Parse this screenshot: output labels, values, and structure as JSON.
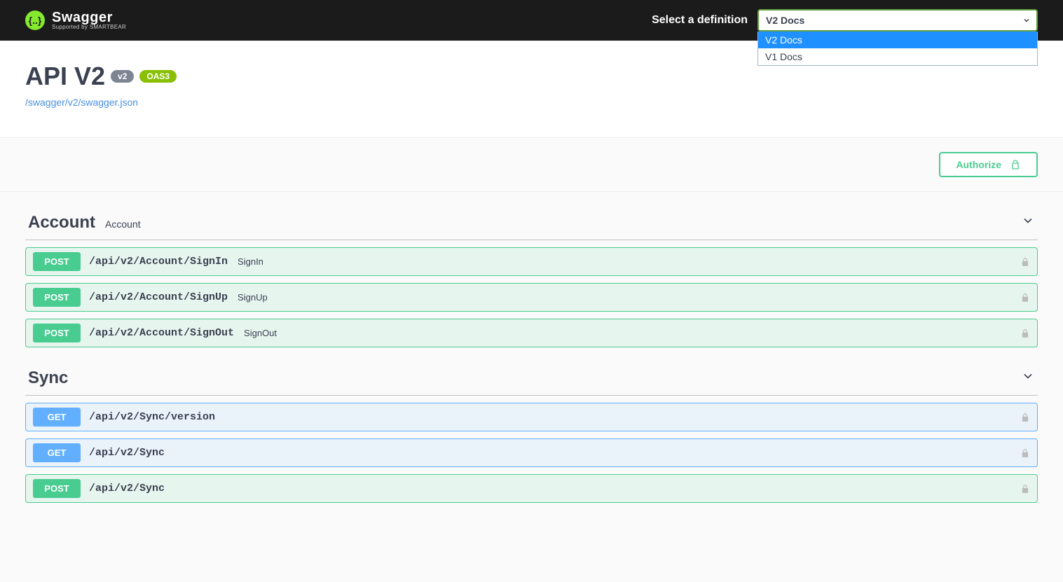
{
  "topbar": {
    "brand": "Swagger",
    "brandSub": "Supported by SMARTBEAR",
    "selectLabel": "Select a definition",
    "selected": "V2 Docs",
    "options": [
      "V2 Docs",
      "V1 Docs"
    ]
  },
  "info": {
    "title": "API V2",
    "version": "v2",
    "oas": "OAS3",
    "specUrl": "/swagger/v2/swagger.json"
  },
  "authorize": {
    "label": "Authorize"
  },
  "tags": [
    {
      "name": "Account",
      "description": "Account",
      "ops": [
        {
          "method": "POST",
          "path": "/api/v2/Account/SignIn",
          "summary": "SignIn"
        },
        {
          "method": "POST",
          "path": "/api/v2/Account/SignUp",
          "summary": "SignUp"
        },
        {
          "method": "POST",
          "path": "/api/v2/Account/SignOut",
          "summary": "SignOut"
        }
      ]
    },
    {
      "name": "Sync",
      "description": "",
      "ops": [
        {
          "method": "GET",
          "path": "/api/v2/Sync/version",
          "summary": ""
        },
        {
          "method": "GET",
          "path": "/api/v2/Sync",
          "summary": ""
        },
        {
          "method": "POST",
          "path": "/api/v2/Sync",
          "summary": ""
        }
      ]
    }
  ]
}
